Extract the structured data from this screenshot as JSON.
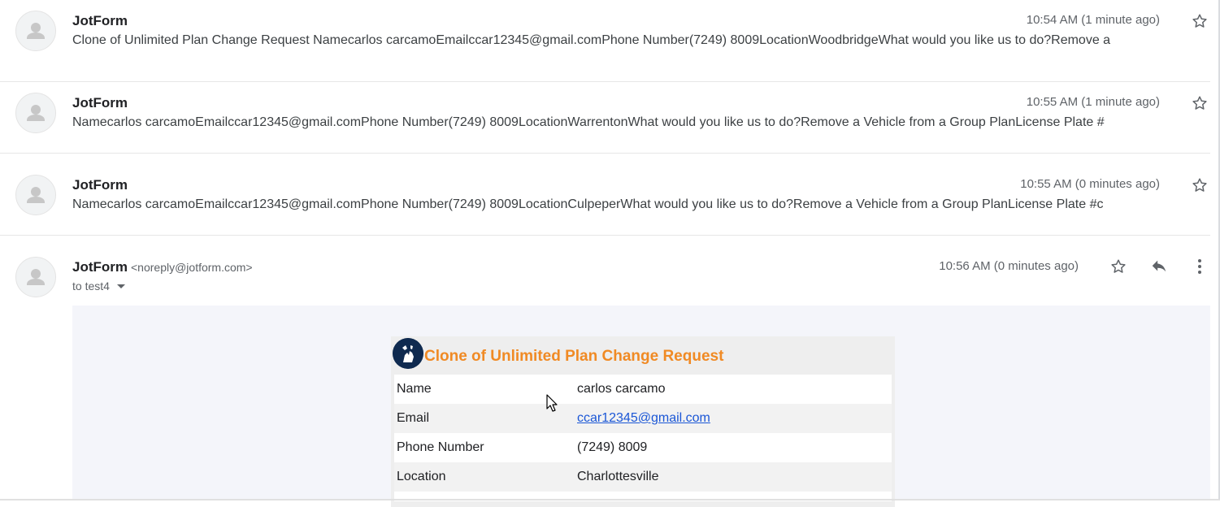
{
  "messages": [
    {
      "sender": "JotForm",
      "time": "10:54 AM (1 minute ago)",
      "snippet": "Clone of Unlimited Plan Change Request Namecarlos carcamoEmailccar12345@gmail.comPhone Number(7249) 8009LocationWoodbridgeWhat would you like us to do?Remove a"
    },
    {
      "sender": "JotForm",
      "time": "10:55 AM (1 minute ago)",
      "snippet": "Namecarlos carcamoEmailccar12345@gmail.comPhone Number(7249) 8009LocationWarrentonWhat would you like us to do?Remove a Vehicle from a Group PlanLicense Plate #"
    },
    {
      "sender": "JotForm",
      "time": "10:55 AM (0 minutes ago)",
      "snippet": "Namecarlos carcamoEmailccar12345@gmail.comPhone Number(7249) 8009LocationCulpeperWhat would you like us to do?Remove a Vehicle from a Group PlanLicense Plate #c"
    }
  ],
  "open_message": {
    "sender": "JotForm",
    "sender_email": "<noreply@jotform.com>",
    "time": "10:56 AM (0 minutes ago)",
    "to_line": "to test4",
    "form": {
      "title": "Clone of Unlimited Plan Change Request",
      "rows": [
        {
          "label": "Name",
          "value": "carlos carcamo"
        },
        {
          "label": "Email",
          "value": "ccar12345@gmail.com"
        },
        {
          "label": "Phone Number",
          "value": "(7249) 8009"
        },
        {
          "label": "Location",
          "value": "Charlottesville"
        }
      ]
    }
  },
  "icons": {
    "avatar": "person-icon",
    "star": "star-outline-icon",
    "reply": "reply-icon",
    "more": "more-vertical-icon",
    "caret": "caret-down-icon",
    "cursor": "mouse-pointer-icon"
  },
  "colors": {
    "form_title": "#f08a24",
    "link": "#1a56d6",
    "body_background": "#f4f5fa"
  }
}
